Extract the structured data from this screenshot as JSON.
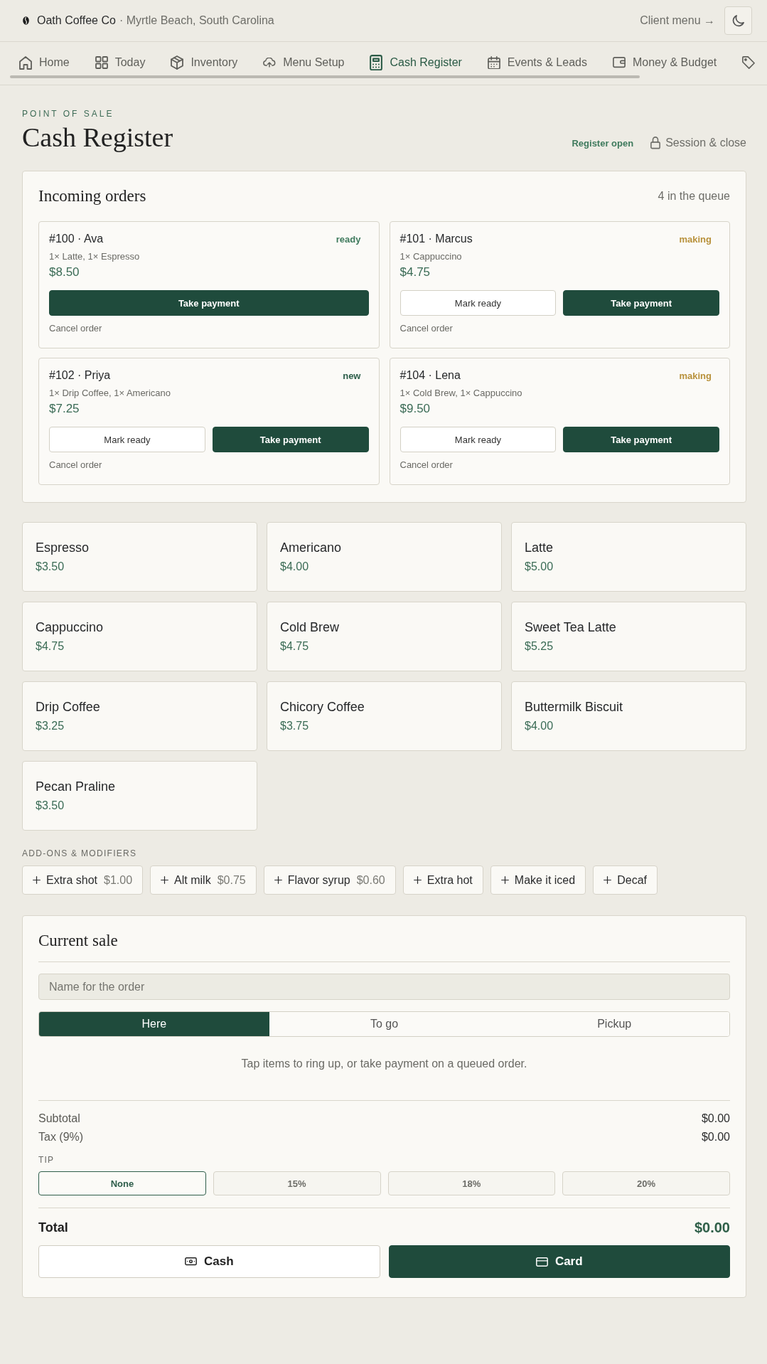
{
  "header": {
    "brand": "Oath Coffee Co",
    "location": "· Myrtle Beach, South Carolina",
    "client_menu": "Client menu →"
  },
  "nav": {
    "items": [
      {
        "label": "Home",
        "selected": false
      },
      {
        "label": "Today",
        "selected": false
      },
      {
        "label": "Inventory",
        "selected": false
      },
      {
        "label": "Menu Setup",
        "selected": false
      },
      {
        "label": "Cash Register",
        "selected": true
      },
      {
        "label": "Events & Leads",
        "selected": false
      },
      {
        "label": "Money & Budget",
        "selected": false
      },
      {
        "selected": false
      }
    ]
  },
  "page": {
    "eyebrow": "POINT OF SALE",
    "title": "Cash Register",
    "register_status": "Register open",
    "session_button": "Session & close"
  },
  "incoming_orders": {
    "title": "Incoming orders",
    "count": "4 in the queue",
    "orders": [
      {
        "title": "#100 · Ava",
        "status": {
          "label": "ready",
          "color": "#3f7a5d"
        },
        "items": "1× Latte, 1× Espresso",
        "total": "$8.50",
        "buttons": [
          {
            "label": "Take payment",
            "kind": "pay"
          }
        ],
        "cancel": "Cancel order"
      },
      {
        "title": "#101 · Marcus",
        "status": {
          "label": "making",
          "color": "#b8913b"
        },
        "items": "1× Cappuccino",
        "total": "$4.75",
        "buttons": [
          {
            "label": "Mark ready",
            "kind": "ready"
          },
          {
            "label": "Take payment",
            "kind": "pay"
          }
        ],
        "cancel": "Cancel order"
      },
      {
        "title": "#102 · Priya",
        "status": {
          "label": "new",
          "color": "#2d5e4a"
        },
        "items": "1× Drip Coffee, 1× Americano",
        "total": "$7.25",
        "buttons": [
          {
            "label": "Mark ready",
            "kind": "ready"
          },
          {
            "label": "Take payment",
            "kind": "pay"
          }
        ],
        "cancel": "Cancel order"
      },
      {
        "title": "#104 · Lena",
        "status": {
          "label": "making",
          "color": "#b8913b"
        },
        "items": "1× Cold Brew, 1× Cappuccino",
        "total": "$9.50",
        "buttons": [
          {
            "label": "Mark ready",
            "kind": "ready"
          },
          {
            "label": "Take payment",
            "kind": "pay"
          }
        ],
        "cancel": "Cancel order"
      }
    ]
  },
  "menu_items": [
    {
      "name": "Espresso",
      "price": "$3.50"
    },
    {
      "name": "Americano",
      "price": "$4.00"
    },
    {
      "name": "Latte",
      "price": "$5.00"
    },
    {
      "name": "Cappuccino",
      "price": "$4.75"
    },
    {
      "name": "Cold Brew",
      "price": "$4.75"
    },
    {
      "name": "Sweet Tea Latte",
      "price": "$5.25"
    },
    {
      "name": "Drip Coffee",
      "price": "$3.25"
    },
    {
      "name": "Chicory Coffee",
      "price": "$3.75"
    },
    {
      "name": "Buttermilk Biscuit",
      "price": "$4.00"
    },
    {
      "name": "Pecan Praline",
      "price": "$3.50"
    }
  ],
  "addons": {
    "title": "ADD-ONS & MODIFIERS",
    "items": [
      {
        "label": "Extra shot",
        "price": "$1.00"
      },
      {
        "label": "Alt milk",
        "price": "$0.75"
      },
      {
        "label": "Flavor syrup",
        "price": "$0.60"
      },
      {
        "label": "Extra hot"
      },
      {
        "label": "Make it iced"
      },
      {
        "label": "Decaf"
      }
    ]
  },
  "current_sale": {
    "title": "Current sale",
    "name_field": {
      "placeholder": "Name for the order"
    },
    "order_types": [
      {
        "label": "Here",
        "selected": true
      },
      {
        "label": "To go",
        "selected": false
      },
      {
        "label": "Pickup",
        "selected": false
      }
    ],
    "empty_hint": "Tap items to ring up, or take payment on a queued order.",
    "subtotal": {
      "label": "Subtotal",
      "value": "$0.00"
    },
    "tax": {
      "label": "Tax (9%)",
      "value": "$0.00"
    },
    "tip": {
      "label": "TIP",
      "options": [
        {
          "label": "None",
          "selected": true
        },
        {
          "label": "15%",
          "selected": false
        },
        {
          "label": "18%",
          "selected": false
        },
        {
          "label": "20%",
          "selected": false
        }
      ]
    },
    "total": {
      "label": "Total",
      "value": "$0.00"
    },
    "payment_buttons": [
      {
        "label": "Cash",
        "kind": "cash"
      },
      {
        "label": "Card",
        "kind": "card"
      }
    ]
  }
}
